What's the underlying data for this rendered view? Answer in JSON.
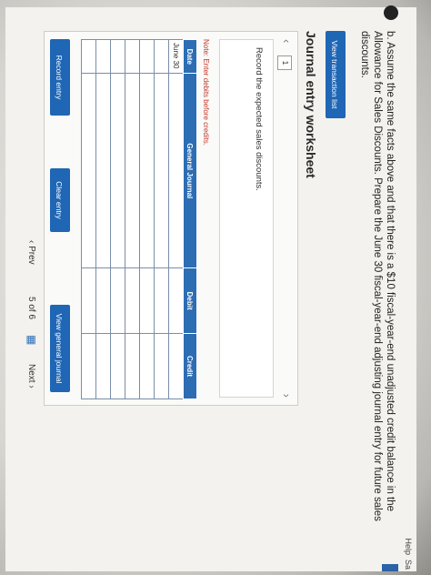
{
  "header": {
    "help_label": "Help",
    "save_label": "Sa"
  },
  "question": {
    "text": "b. Assume the same facts above and that there is a $10 fiscal-year-end unadjusted credit balance in the Allowance for Sales Discounts. Prepare the June 30 fiscal-year-end adjusting journal entry for future sales discounts."
  },
  "buttons": {
    "view_transaction_list": "View transaction list",
    "record_entry": "Record entry",
    "clear_entry": "Clear entry",
    "view_general_journal": "View general journal"
  },
  "worksheet": {
    "title": "Journal entry worksheet",
    "current_page": "1",
    "instruction": "Record the expected sales discounts.",
    "note": "Note: Enter debits before credits."
  },
  "journal": {
    "headers": [
      "Date",
      "General Journal",
      "Debit",
      "Credit"
    ],
    "rows": [
      [
        "June 30",
        "",
        "",
        ""
      ],
      [
        "",
        "",
        "",
        ""
      ],
      [
        "",
        "",
        "",
        ""
      ],
      [
        "",
        "",
        "",
        ""
      ],
      [
        "",
        "",
        "",
        ""
      ],
      [
        "",
        "",
        "",
        ""
      ],
      [
        "",
        "",
        "",
        ""
      ]
    ]
  },
  "pagination": {
    "prev_label": "Prev",
    "page_text": "5 of 6",
    "next_label": "Next"
  },
  "colors": {
    "accent": "#1f66b5",
    "table_header": "#2d6db3",
    "note_red": "#c0392b"
  }
}
